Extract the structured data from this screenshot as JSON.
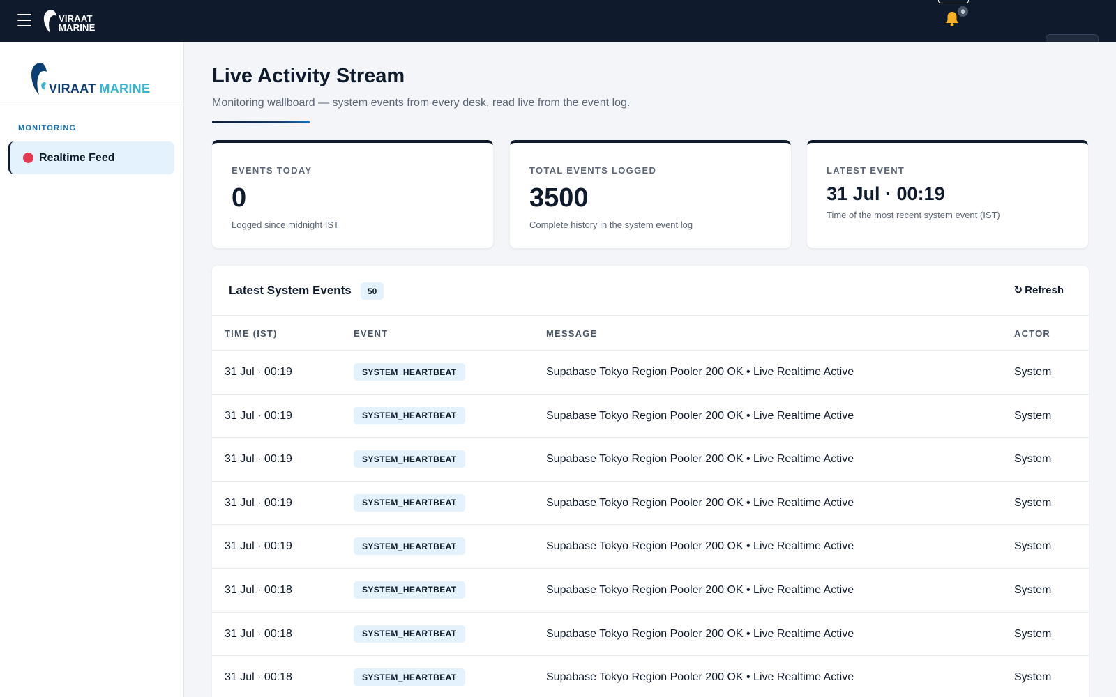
{
  "topbar": {
    "logo_line1": "VIRAAT",
    "logo_line2": "MARINE",
    "notification_count": "0"
  },
  "sidebar": {
    "logo_word1": "VIRAAT",
    "logo_word2": "MARINE",
    "section_label": "MONITORING",
    "items": [
      {
        "label": "Realtime Feed",
        "status_color": "#e53950"
      }
    ]
  },
  "header": {
    "title": "Live Activity Stream",
    "subtitle": "Monitoring wallboard — system events from every desk, read live from the event log."
  },
  "stats": [
    {
      "label": "EVENTS TODAY",
      "value": "0",
      "note": "Logged since midnight IST"
    },
    {
      "label": "TOTAL EVENTS LOGGED",
      "value": "3500",
      "note": "Complete history in the system event log"
    },
    {
      "label": "LATEST EVENT",
      "value": "31 Jul · 00:19",
      "note": "Time of the most recent system event (IST)"
    }
  ],
  "events_panel": {
    "title": "Latest System Events",
    "count": "50",
    "refresh_label": "Refresh",
    "columns": [
      "TIME (IST)",
      "EVENT",
      "MESSAGE",
      "ACTOR"
    ],
    "rows": [
      {
        "time": "31 Jul · 00:19",
        "event": "SYSTEM_HEARTBEAT",
        "message": "Supabase Tokyo Region Pooler 200 OK • Live Realtime Active",
        "actor": "System"
      },
      {
        "time": "31 Jul · 00:19",
        "event": "SYSTEM_HEARTBEAT",
        "message": "Supabase Tokyo Region Pooler 200 OK • Live Realtime Active",
        "actor": "System"
      },
      {
        "time": "31 Jul · 00:19",
        "event": "SYSTEM_HEARTBEAT",
        "message": "Supabase Tokyo Region Pooler 200 OK • Live Realtime Active",
        "actor": "System"
      },
      {
        "time": "31 Jul · 00:19",
        "event": "SYSTEM_HEARTBEAT",
        "message": "Supabase Tokyo Region Pooler 200 OK • Live Realtime Active",
        "actor": "System"
      },
      {
        "time": "31 Jul · 00:19",
        "event": "SYSTEM_HEARTBEAT",
        "message": "Supabase Tokyo Region Pooler 200 OK • Live Realtime Active",
        "actor": "System"
      },
      {
        "time": "31 Jul · 00:18",
        "event": "SYSTEM_HEARTBEAT",
        "message": "Supabase Tokyo Region Pooler 200 OK • Live Realtime Active",
        "actor": "System"
      },
      {
        "time": "31 Jul · 00:18",
        "event": "SYSTEM_HEARTBEAT",
        "message": "Supabase Tokyo Region Pooler 200 OK • Live Realtime Active",
        "actor": "System"
      },
      {
        "time": "31 Jul · 00:18",
        "event": "SYSTEM_HEARTBEAT",
        "message": "Supabase Tokyo Region Pooler 200 OK • Live Realtime Active",
        "actor": "System"
      }
    ]
  },
  "icons": {
    "menu": "hamburger-icon",
    "notifications": "bell-icon",
    "refresh": "refresh-icon",
    "status": "status-dot-icon"
  },
  "colors": {
    "topbar_bg": "#0f1b2d",
    "accent_blue": "#1670b5",
    "logo_cyan": "#34b6d4",
    "badge_bg": "#e3f2fc",
    "live_dot": "#e53950",
    "bell": "#f6b026"
  }
}
